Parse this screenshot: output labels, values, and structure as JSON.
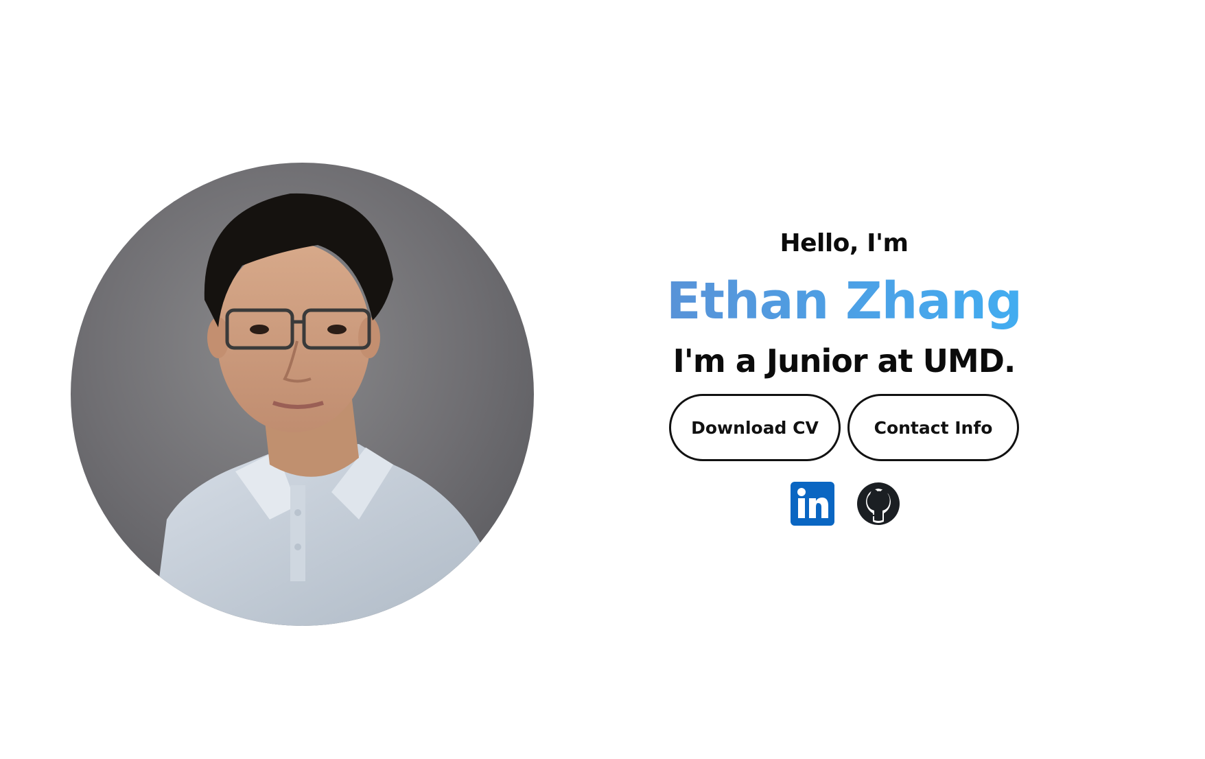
{
  "hero": {
    "greeting": "Hello, I'm",
    "name": "Ethan Zhang",
    "tagline": "I'm a Junior at UMD."
  },
  "buttons": {
    "download_cv": "Download CV",
    "contact_info": "Contact Info"
  },
  "socials": [
    {
      "icon": "linkedin-icon",
      "color": "#0a66c2"
    },
    {
      "icon": "github-icon",
      "color": "#1b1f23"
    }
  ],
  "colors": {
    "name_gradient_start": "#5b8fd4",
    "name_gradient_end": "#3fb0f3",
    "text": "#0b0b0b"
  }
}
